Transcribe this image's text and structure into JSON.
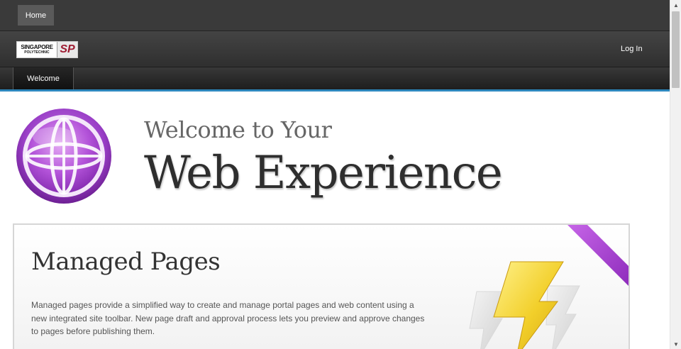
{
  "top_bar": {
    "home_label": "Home"
  },
  "header": {
    "logo": {
      "line1": "SINGAPORE",
      "line2": "POLYTECHNIC",
      "mark": "SP",
      "icon": "singapore-polytechnic-logo"
    },
    "login_label": "Log In"
  },
  "nav": {
    "tabs": [
      {
        "label": "Welcome"
      }
    ]
  },
  "hero": {
    "line1": "Welcome to Your",
    "line2": "Web Experience",
    "icon": "globe-icon"
  },
  "card": {
    "title": "Managed Pages",
    "description": "Managed pages provide a simplified way to create and manage portal pages and web content using a new integrated site toolbar. New page draft and approval process lets you preview and approve changes to pages before publishing them.",
    "icon": "lightning-bolts-icon"
  },
  "colors": {
    "accent": "#2d87bd",
    "brand_purple": "#9a3fc7",
    "logo_red": "#9e1b32",
    "bolt_yellow": "#f2cf2a"
  }
}
